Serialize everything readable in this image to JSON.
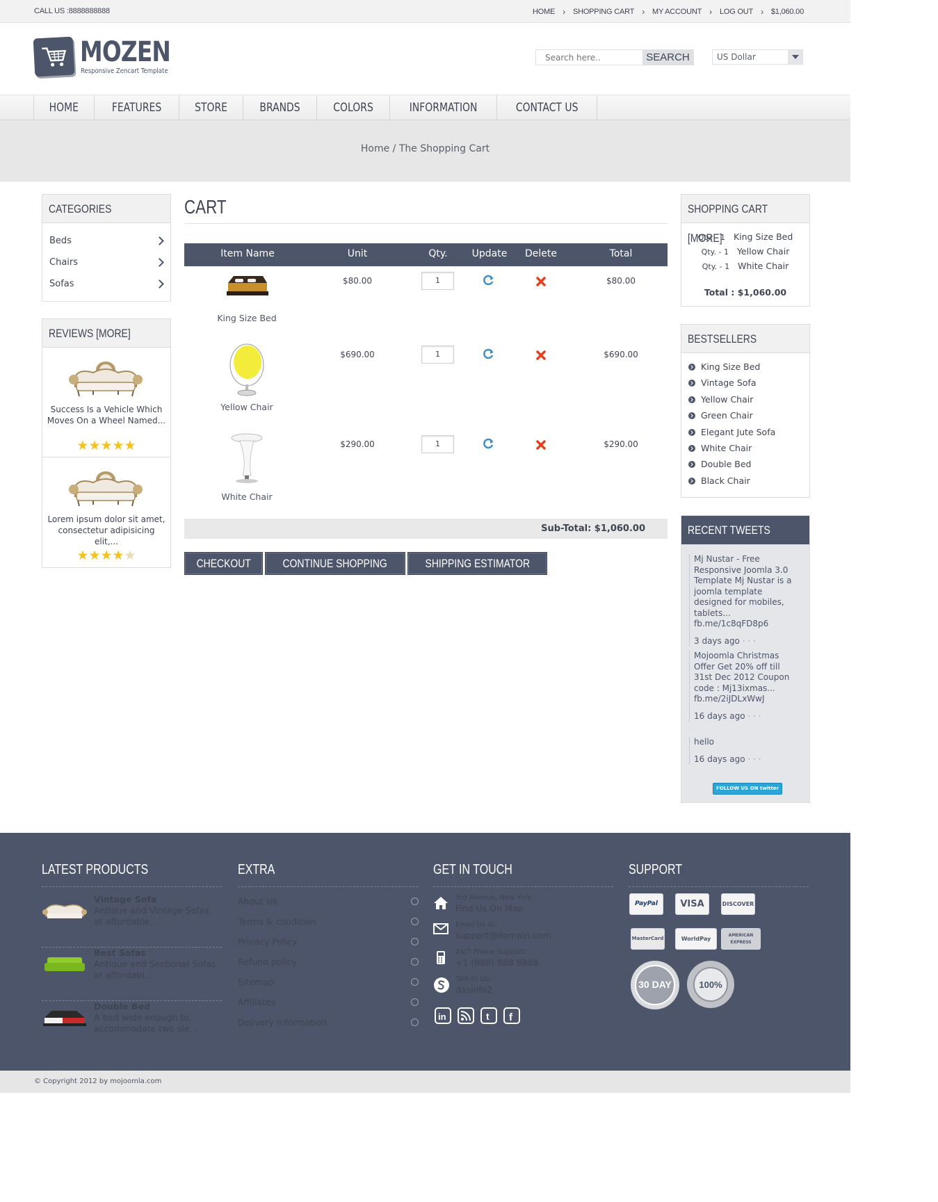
{
  "topbar": {
    "call": "CALL US :8888888888",
    "links": [
      "HOME",
      "SHOPPING CART",
      "MY ACCOUNT",
      "LOG OUT",
      "$1,060.00"
    ]
  },
  "header": {
    "logo": "MOZEN",
    "tagline": "Responsive Zencart Template",
    "search_placeholder": "Search here..",
    "search_button": "SEARCH",
    "currency": "US Dollar"
  },
  "nav": [
    "HOME",
    "FEATURES",
    "STORE",
    "BRANDS",
    "COLORS",
    "INFORMATION",
    "CONTACT US"
  ],
  "breadcrumb": {
    "home": "Home",
    "sep": " / ",
    "current": "The Shopping Cart"
  },
  "categories": {
    "title": "CATEGORIES",
    "items": [
      "Beds",
      "Chairs",
      "Sofas"
    ]
  },
  "reviews": {
    "title": "REVIEWS [MORE]",
    "items": [
      {
        "text": "Success Is a Vehicle Which Moves On a Wheel Named...",
        "rating": 5
      },
      {
        "text": "Lorem ipsum dolor sit amet, consectetur adipisicing elit,...",
        "rating": 4
      }
    ]
  },
  "cart": {
    "title": "CART",
    "columns": [
      "Item Name",
      "Unit",
      "Qty.",
      "Update",
      "Delete",
      "Total"
    ],
    "items": [
      {
        "name": "King Size Bed",
        "unit": "$80.00",
        "qty": "1",
        "total": "$80.00"
      },
      {
        "name": "Yellow Chair",
        "unit": "$690.00",
        "qty": "1",
        "total": "$690.00"
      },
      {
        "name": "White Chair",
        "unit": "$290.00",
        "qty": "1",
        "total": "$290.00"
      }
    ],
    "subtotal": "Sub-Total: $1,060.00",
    "buttons": [
      "CHECKOUT",
      "CONTINUE SHOPPING",
      "SHIPPING ESTIMATOR"
    ]
  },
  "minicart": {
    "title": "SHOPPING CART [MORE]",
    "items": [
      {
        "qty": "Qty. - 1",
        "name": "King Size Bed"
      },
      {
        "qty": "Qty. - 1",
        "name": "Yellow Chair"
      },
      {
        "qty": "Qty. - 1",
        "name": "White Chair"
      }
    ],
    "total": "Total : $1,060.00"
  },
  "bestsellers": {
    "title": "BESTSELLERS",
    "items": [
      "King Size Bed",
      "Vintage Sofa",
      "Yellow Chair",
      "Green Chair",
      "Elegant Jute Sofa",
      "White Chair",
      "Double Bed",
      "Black Chair"
    ]
  },
  "tweets": {
    "title": "RECENT TWEETS",
    "items": [
      {
        "text": "Mj Nustar - Free Responsive Joomla 3.0 Template Mj Nustar is a joomla template designed for mobiles, tablets...",
        "link": "fb.me/1c8qFD8p6",
        "ago": "3 days ago"
      },
      {
        "text": "Mojoomla Christmas Offer Get 20% off till 31st Dec 2012 Coupon code : Mj13ixmas...",
        "link": "fb.me/2iJDLxWwJ",
        "ago": "16 days ago"
      },
      {
        "text": "hello",
        "link": "",
        "ago": "16 days ago"
      }
    ],
    "follow": "FOLLOW US ON twitter"
  },
  "footer": {
    "latest": {
      "title": "LATEST PRODUCTS",
      "items": [
        {
          "name": "Vintage Sofa",
          "desc": "Antique and Vintage Sofas at affordable..."
        },
        {
          "name": "Best Sofas",
          "desc": "Antique and Sectional Sofas at affordabl..."
        },
        {
          "name": "Double Bed",
          "desc": "A bed wide enough to accommodate two sle..."
        }
      ]
    },
    "extra": {
      "title": "EXTRA",
      "items": [
        "About Us",
        "Terms & condition",
        "Privacy Policy",
        "Refund policy",
        "Sitemap",
        "Affiliates",
        "Delivery Information"
      ]
    },
    "contact": {
      "title": "GET IN TOUCH",
      "items": [
        {
          "small": "3rd Avenue, New York",
          "big": "Find Us On Map"
        },
        {
          "small": "Email Us At:",
          "big": "support@domain.com"
        },
        {
          "small": "24/7 Phone Support:",
          "big": "+1 (888) 888 8888"
        },
        {
          "small": "Talk to Us:",
          "big": "dasinfo2"
        }
      ]
    },
    "support": {
      "title": "SUPPORT",
      "cards": [
        "PayPal",
        "VISA",
        "DISCOVER",
        "MasterCard",
        "WorldPay",
        "AMERICAN EXPRESS"
      ],
      "badge1": "30 DAY",
      "badge2": "100%"
    }
  },
  "copyright": "© Copyright 2012 by mojoomla.com"
}
